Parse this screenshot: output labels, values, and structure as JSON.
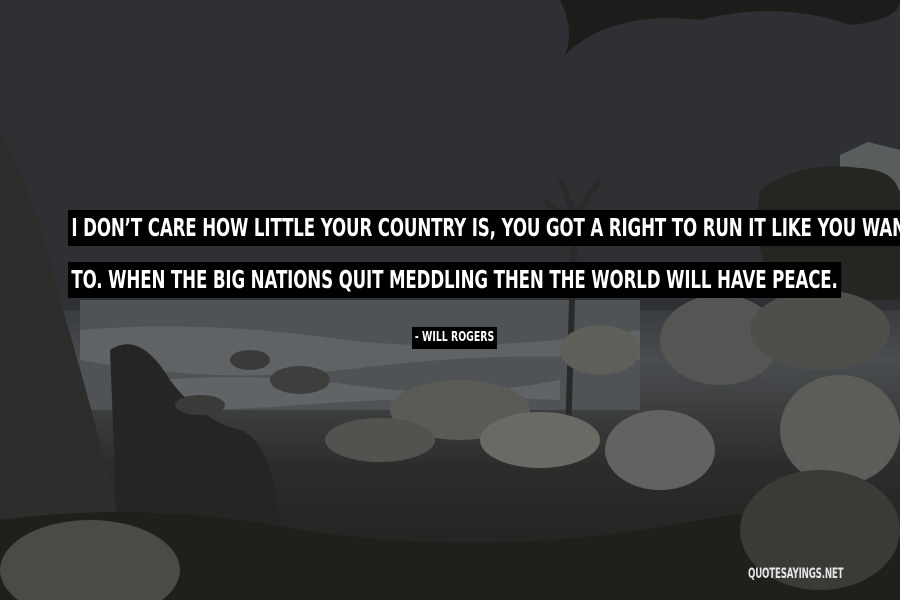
{
  "quote": {
    "line1": "I DON’T CARE HOW LITTLE YOUR COUNTRY IS, YOU GOT A RIGHT TO RUN IT LIKE YOU WANT",
    "line2": "TO. WHEN THE BIG NATIONS QUIT MEDDLING THEN THE WORLD WILL HAVE PEACE.",
    "author": "- WILL ROGERS"
  },
  "watermark": "QUOTESAYINGS.NET",
  "colors": {
    "sky": "#2f3134",
    "sea": "#55595c",
    "rock": "#3b3c39",
    "text_bg": "#000000",
    "text": "#ffffff"
  }
}
